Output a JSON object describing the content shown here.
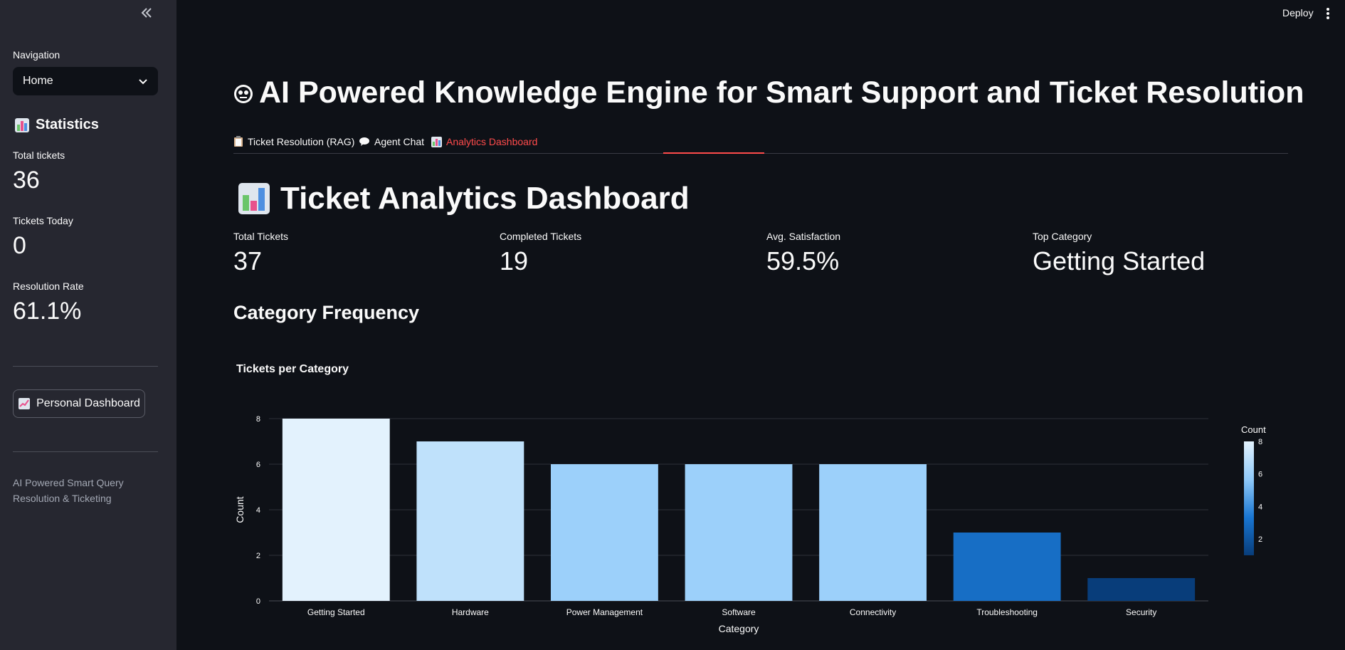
{
  "sidebar": {
    "collapse_icon": "double-chevron-left-icon",
    "nav_label": "Navigation",
    "nav_selected": "Home",
    "stats_heading": "Statistics",
    "stats_icon": "bar-chart-icon",
    "metrics": [
      {
        "label": "Total tickets",
        "value": "36"
      },
      {
        "label": "Tickets Today",
        "value": "0"
      },
      {
        "label": "Resolution Rate",
        "value": "61.1%"
      }
    ],
    "personal_button": "Personal Dashboard",
    "personal_icon": "trend-chart-icon",
    "footer": "AI Powered Smart Query Resolution & Ticketing"
  },
  "header": {
    "deploy_label": "Deploy",
    "menu_icon": "kebab-menu-icon"
  },
  "main": {
    "title": "AI Powered Knowledge Engine for Smart Support and Ticket Resolution",
    "title_icon": "robot-face-icon",
    "tabs": [
      {
        "label": "Ticket Resolution (RAG)",
        "icon": "clipboard-icon",
        "active": false
      },
      {
        "label": "Agent Chat",
        "icon": "speech-bubble-icon",
        "active": false
      },
      {
        "label": "Analytics Dashboard",
        "icon": "bar-chart-icon",
        "active": true
      }
    ],
    "accent_color": "#ff4b4b",
    "dashboard_title": "Ticket Analytics Dashboard",
    "kpis": [
      {
        "label": "Total Tickets",
        "value": "37"
      },
      {
        "label": "Completed Tickets",
        "value": "19"
      },
      {
        "label": "Avg. Satisfaction",
        "value": "59.5%"
      },
      {
        "label": "Top Category",
        "value": "Getting Started"
      }
    ],
    "section_title": "Category Frequency"
  },
  "chart_data": {
    "type": "bar",
    "title": "Tickets per Category",
    "xlabel": "Category",
    "ylabel": "Count",
    "categories": [
      "Getting Started",
      "Hardware",
      "Power Management",
      "Software",
      "Connectivity",
      "Troubleshooting",
      "Security"
    ],
    "values": [
      8,
      7,
      6,
      6,
      6,
      3,
      1
    ],
    "ylim": [
      0,
      8
    ],
    "yticks": [
      0,
      2,
      4,
      6,
      8
    ],
    "grid": true,
    "colorscale": {
      "title": "Count",
      "ticks": [
        2,
        4,
        6,
        8
      ],
      "range": [
        1,
        8
      ],
      "colors": [
        "#083d7a",
        "#1976d2",
        "#90caf9",
        "#e3f2fd"
      ]
    }
  }
}
